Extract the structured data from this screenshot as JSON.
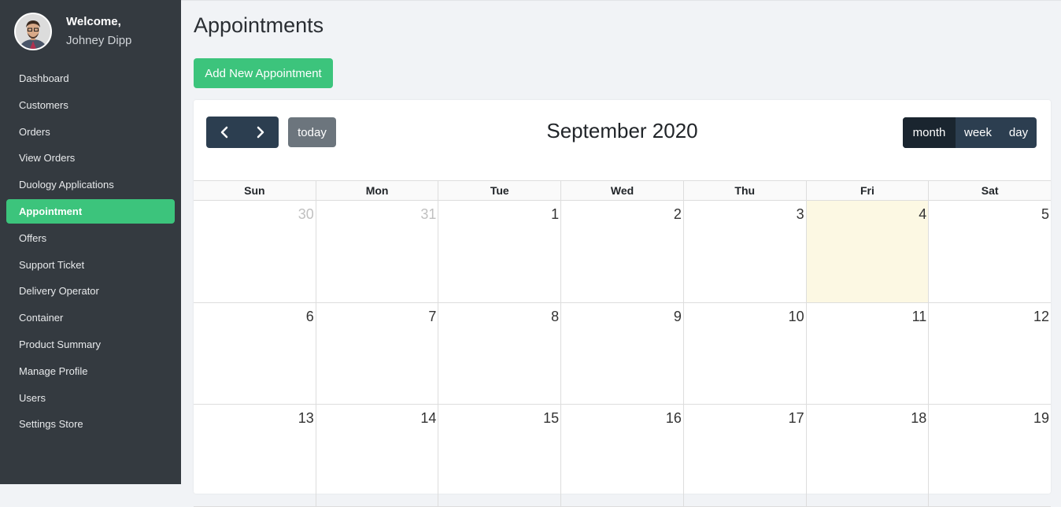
{
  "profile": {
    "welcome": "Welcome,",
    "name": "Johney Dipp"
  },
  "sidebar": {
    "items": [
      {
        "label": "Dashboard",
        "active": false
      },
      {
        "label": "Customers",
        "active": false
      },
      {
        "label": "Orders",
        "active": false
      },
      {
        "label": "View Orders",
        "active": false
      },
      {
        "label": "Duology Applications",
        "active": false
      },
      {
        "label": "Appointment",
        "active": true
      },
      {
        "label": "Offers",
        "active": false
      },
      {
        "label": "Support Ticket",
        "active": false
      },
      {
        "label": "Delivery Operator",
        "active": false
      },
      {
        "label": "Container",
        "active": false
      },
      {
        "label": "Product Summary",
        "active": false
      },
      {
        "label": "Manage Profile",
        "active": false
      },
      {
        "label": "Users",
        "active": false
      },
      {
        "label": "Settings Store",
        "active": false
      }
    ]
  },
  "main": {
    "title": "Appointments",
    "add_button": "Add New Appointment"
  },
  "calendar": {
    "today_label": "today",
    "month_title": "September 2020",
    "views": [
      {
        "label": "month",
        "active": true
      },
      {
        "label": "week",
        "active": false
      },
      {
        "label": "day",
        "active": false
      }
    ],
    "weekdays": [
      "Sun",
      "Mon",
      "Tue",
      "Wed",
      "Thu",
      "Fri",
      "Sat"
    ],
    "weeks": [
      [
        {
          "d": "30",
          "other": true
        },
        {
          "d": "31",
          "other": true
        },
        {
          "d": "1"
        },
        {
          "d": "2"
        },
        {
          "d": "3"
        },
        {
          "d": "4",
          "today": true
        },
        {
          "d": "5"
        }
      ],
      [
        {
          "d": "6"
        },
        {
          "d": "7"
        },
        {
          "d": "8"
        },
        {
          "d": "9"
        },
        {
          "d": "10"
        },
        {
          "d": "11"
        },
        {
          "d": "12"
        }
      ],
      [
        {
          "d": "13"
        },
        {
          "d": "14"
        },
        {
          "d": "15"
        },
        {
          "d": "16"
        },
        {
          "d": "17"
        },
        {
          "d": "18"
        },
        {
          "d": "19"
        }
      ]
    ]
  },
  "colors": {
    "sidebar_bg": "#343a40",
    "accent_green": "#3cc47c",
    "button_dark": "#2c3e50",
    "today_highlight": "#fcf8e3"
  }
}
